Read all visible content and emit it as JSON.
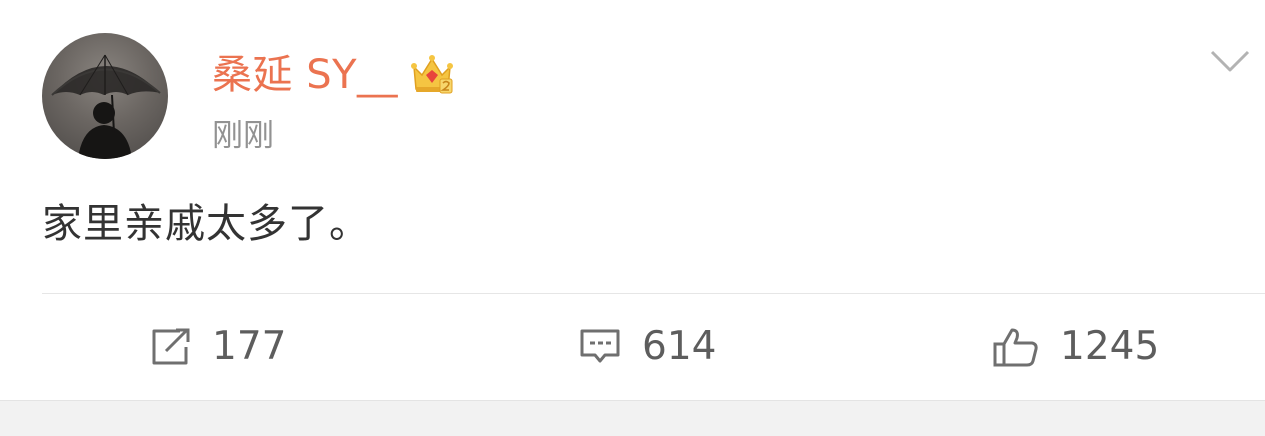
{
  "post": {
    "author": {
      "name": "桑延 SY__",
      "badge_icon": "crown-vip-icon",
      "avatar_icon": "avatar-umbrella-silhouette"
    },
    "timestamp": "刚刚",
    "text": "家里亲戚太多了。",
    "menu_icon": "chevron-down-icon"
  },
  "actions": {
    "repost": {
      "icon": "repost-icon",
      "count": "177"
    },
    "comment": {
      "icon": "comment-icon",
      "count": "614"
    },
    "like": {
      "icon": "thumbs-up-icon",
      "count": "1245"
    }
  },
  "colors": {
    "username": "#eb7350",
    "timestamp": "#929292",
    "text": "#333333",
    "action_text": "#5d5d5d",
    "divider": "#e6e6e6",
    "footer_bg": "#f2f2f2"
  }
}
